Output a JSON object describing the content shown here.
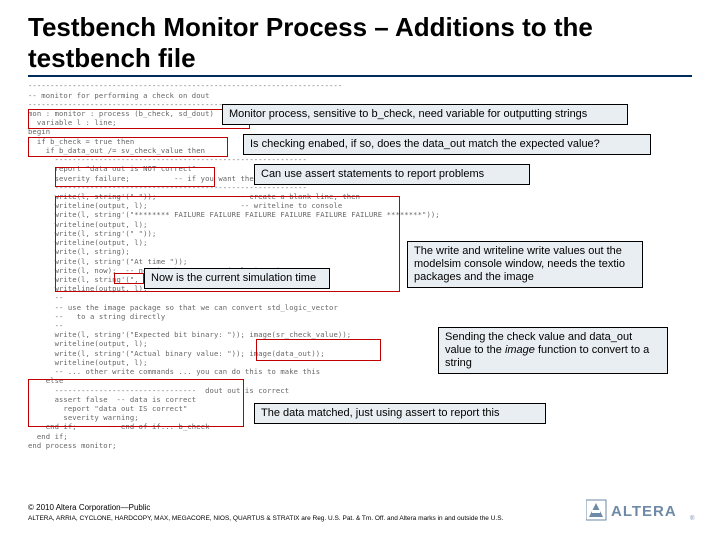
{
  "title": "Testbench Monitor Process – Additions to the testbench file",
  "code": "-----------------------------------------------------------------------\n-- monitor for performing a check on dout\n-----------------------------------------------------------------------\nmon : monitor : process (b_check, sd_dout)\n  variable l : line;\nbegin\n  if b_check = true then\n    if b_data_out /= sv_check_value then\n      ---------------------------------------------------------\n      report \"data out is NOT correct\"\n      severity failure;          -- if you want the simulation to stop\n      ---------------------------------------------------------\n      write(l, string'(\" \"));                  -- create a blank line, then\n      writeline(output, l);                     -- writeline to console\n      write(l, string'(\"******** FAILURE FAILURE FAILURE FAILURE FAILURE FAILURE ********\"));\n      writeline(output, l);\n      write(l, string'(\" \"));\n      writeline(output, l);\n      write(l, string);\n      write(l, string'(\"At time \"));\n      write(l, now);  -- now is the current simulation time\n      write(l, string'(\", the data did not match: \"));\n      writeline(output, l);\n      --\n      -- use the image package so that we can convert std_logic_vector\n      --   to a string directly\n      --\n      write(l, string'(\"Expected bit binary: \")); image(sr_check_value));\n      writeline(output, l);\n      write(l, string'(\"Actual binary value: \")); image(data_out));\n      writeline(output, l);\n      -- ... other write commands ... you can do this to make this\n    else\n      --------------------------------  dout out is correct\n      assert false  -- data is correct\n        report \"data out IS correct\"\n        severity warning;\n    end if;       -- end of if... b_check\n  end if;\nend process monitor;",
  "callouts": {
    "c1": "Monitor process, sensitive to b_check, need variable for outputting strings",
    "c2": "Is checking enabed, if so, does the data_out match the expected value?",
    "c3": "Can use assert statements to report problems",
    "c4": "Now is the current simulation time",
    "c5": "The write and writeline write values out the modelsim console window, needs the textio packages and the image",
    "c6_a": "Sending the check value and data_out value to the ",
    "c6_b": "image",
    "c6_c": " function to convert to a string",
    "c7": "The data matched, just using assert to report this"
  },
  "footer": {
    "copyright": "© 2010 Altera Corporation—Public",
    "legal": "ALTERA, ARRIA, CYCLONE, HARDCOPY, MAX, MEGACORE, NIOS, QUARTUS & STRATIX are Reg. U.S. Pat. & Tm. Off. and Altera marks in and outside the U.S.",
    "brand": "ALTERA"
  }
}
